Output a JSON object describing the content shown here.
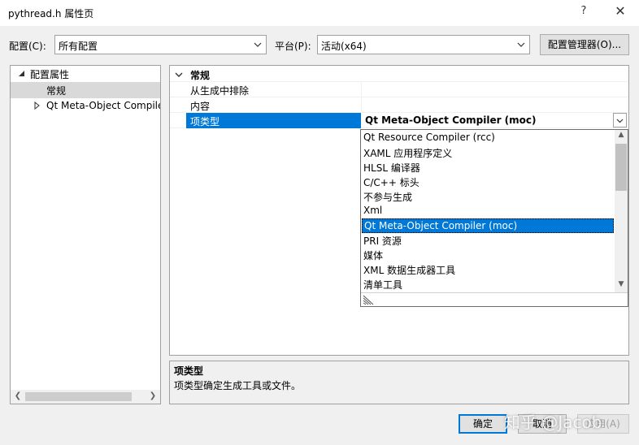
{
  "window": {
    "title": "pythread.h 属性页",
    "help_glyph": "?",
    "close_glyph": "✕"
  },
  "toolbar": {
    "config_label": "配置(C):",
    "config_value": "所有配置",
    "platform_label": "平台(P):",
    "platform_value": "活动(x64)",
    "config_manager_label": "配置管理器(O)..."
  },
  "tree": {
    "root_label": "配置属性",
    "items": [
      {
        "label": "常规",
        "selected": true
      },
      {
        "label": "Qt Meta-Object Compiler",
        "selected": false
      }
    ]
  },
  "grid": {
    "category": "常规",
    "rows": [
      {
        "name": "从生成中排除",
        "value": ""
      },
      {
        "name": "内容",
        "value": ""
      },
      {
        "name": "项类型",
        "value": "Qt Meta-Object Compiler (moc)"
      }
    ]
  },
  "dropdown": {
    "options": [
      "Qt Resource Compiler (rcc)",
      "XAML 应用程序定义",
      "HLSL 编译器",
      "C/C++ 标头",
      "不参与生成",
      "Xml",
      "Qt Meta-Object Compiler (moc)",
      "PRI 资源",
      "媒体",
      "XML 数据生成器工具",
      "清单工具"
    ],
    "selected_index": 6
  },
  "description": {
    "title": "项类型",
    "text": "项类型确定生成工具或文件。"
  },
  "buttons": {
    "ok": "确定",
    "cancel": "取消",
    "apply": "应用(A)"
  },
  "watermark": "知乎 @Jacob",
  "colors": {
    "accent": "#0078d7",
    "selection_gray": "#d9d9d9",
    "background": "#f0f0f0"
  }
}
